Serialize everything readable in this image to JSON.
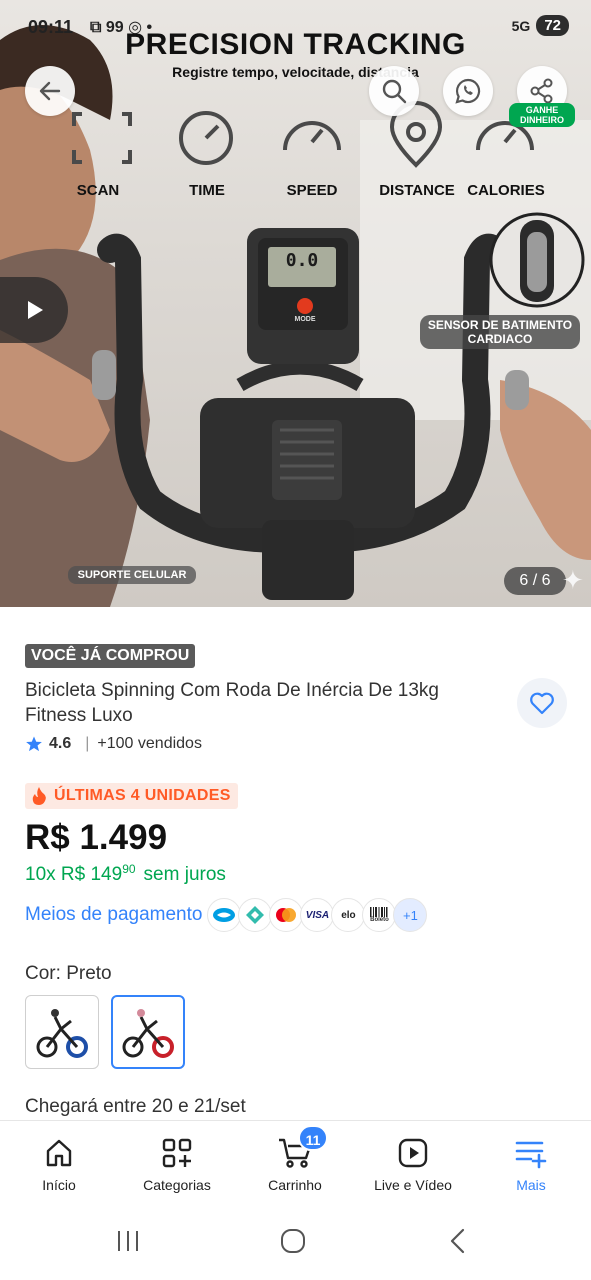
{
  "status_bar": {
    "time": "09:11",
    "left_icons": "⧉ 99 ◎ •",
    "network": "5G",
    "battery": "72"
  },
  "gallery": {
    "promo_title": "PRECISION TRACKING",
    "promo_subtitle": "Registre tempo, velocitade, distancia",
    "features": [
      "SCAN",
      "TIME",
      "SPEED",
      "DISTANCE",
      "CALORIES"
    ],
    "monitor_display": "0.0",
    "monitor_mode": "MODE",
    "sensor_label": "SENSOR DE BATIMENTO CARDIACO",
    "support_label": "SUPORTE CELULAR",
    "counter": "6 / 6",
    "earn_badge": "GANHE DINHEIRO"
  },
  "product": {
    "purchased_badge": "VOCÊ JÁ COMPROU",
    "title": "Bicicleta Spinning Com Roda De Inércia De 13kg Fitness Luxo",
    "rating": "4.6",
    "sold": "+100 vendidos",
    "urgency": "ÚLTIMAS 4 UNIDADES",
    "price": "R$ 1.499",
    "installments_prefix": "10x R$ 149",
    "installments_cents": "90",
    "installments_suffix": "sem juros",
    "payment_link": "Meios de pagamento",
    "payment_icons": [
      "mercado-pago",
      "pix",
      "mastercard",
      "VISA",
      "elo",
      "Boleto"
    ],
    "payment_more": "+1",
    "color_label": "Cor:",
    "color_value": "Preto",
    "delivery": "Chegará entre 20 e 21/set"
  },
  "bottom_nav": {
    "items": [
      {
        "label": "Início",
        "icon": "home-icon"
      },
      {
        "label": "Categorias",
        "icon": "categories-icon"
      },
      {
        "label": "Carrinho",
        "icon": "cart-icon",
        "badge": "11"
      },
      {
        "label": "Live e Vídeo",
        "icon": "video-icon"
      },
      {
        "label": "Mais",
        "icon": "menu-plus-icon"
      }
    ],
    "active": "Mais"
  },
  "colors": {
    "accent_blue": "#3483fa",
    "green": "#00a650",
    "urgency_orange": "#ff5a26"
  }
}
